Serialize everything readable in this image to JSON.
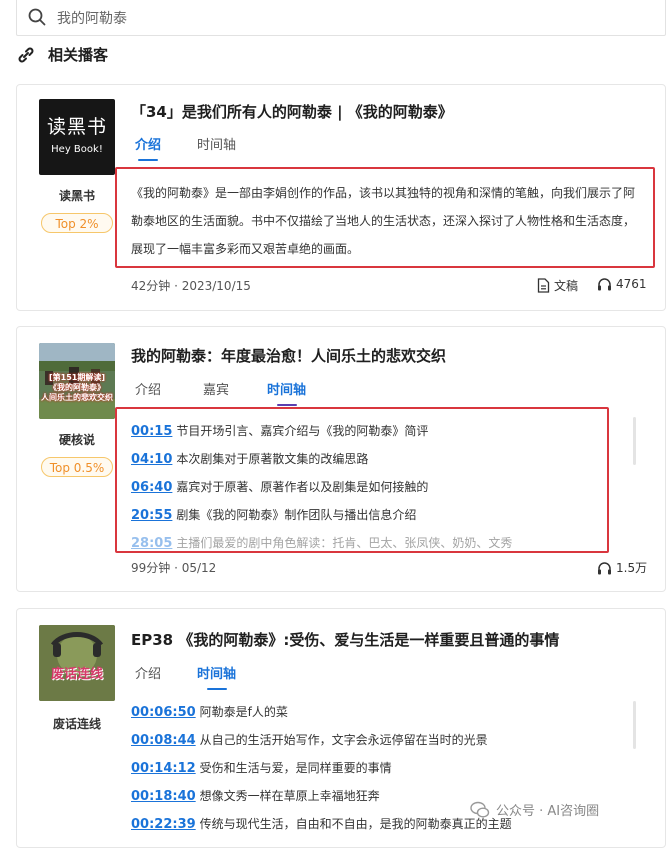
{
  "search": {
    "value": "我的阿勒泰"
  },
  "section": {
    "title": "相关播客"
  },
  "cards": [
    {
      "cover": {
        "line1": "读黑书",
        "line2": "Hey Book!"
      },
      "podcast": "读黑书",
      "badge": "Top 2%",
      "title": "「34」是我们所有人的阿勒泰 | 《我的阿勒泰》",
      "tabs": [
        "介绍",
        "时间轴"
      ],
      "active_tab": "介绍",
      "description": "《我的阿勒泰》是一部由李娟创作的作品，该书以其独特的视角和深情的笔触，向我们展示了阿勒泰地区的生活面貌。书中不仅描绘了当地人的生活状态，还深入探讨了人物性格和生活态度，展现了一幅丰富多彩而又艰苦卓绝的画面。",
      "meta": "42分钟 · 2023/10/15",
      "doc_label": "文稿",
      "plays": "4761"
    },
    {
      "cover": {
        "caption": "[第151期解读]\n《我的阿勒泰》\n人间乐土的悲欢交织"
      },
      "podcast": "硬核说",
      "badge": "Top 0.5%",
      "title": "我的阿勒泰：年度最治愈！人间乐土的悲欢交织",
      "tabs": [
        "介绍",
        "嘉宾",
        "时间轴"
      ],
      "active_tab": "时间轴",
      "timeline": [
        {
          "time": "00:15",
          "text": "节目开场引言、嘉宾介绍与《我的阿勒泰》简评"
        },
        {
          "time": "04:10",
          "text": "本次剧集对于原著散文集的改编思路"
        },
        {
          "time": "06:40",
          "text": "嘉宾对于原著、原著作者以及剧集是如何接触的"
        },
        {
          "time": "20:55",
          "text": "剧集《我的阿勒泰》制作团队与播出信息介绍"
        },
        {
          "time": "28:05",
          "text": "主播们最爱的剧中角色解读：托肯、巴太、张凤侠、奶奶、文秀"
        }
      ],
      "meta": "99分钟 · 05/12",
      "plays": "1.5万"
    },
    {
      "cover": {
        "caption": "废话连线"
      },
      "podcast": "废话连线",
      "title": "EP38 《我的阿勒泰》:受伤、爱与生活是一样重要且普通的事情",
      "tabs": [
        "介绍",
        "时间轴"
      ],
      "active_tab": "时间轴",
      "timeline": [
        {
          "time": "00:06:50",
          "text": "阿勒泰是f人的菜"
        },
        {
          "time": "00:08:44",
          "text": "从自己的生活开始写作，文字会永远停留在当时的光景"
        },
        {
          "time": "00:14:12",
          "text": "受伤和生活与爱，是同样重要的事情"
        },
        {
          "time": "00:18:40",
          "text": "想像文秀一样在草原上幸福地狂奔"
        },
        {
          "time": "00:22:39",
          "text": "传统与现代生活，自由和不自由，是我的阿勒泰真正的主题"
        }
      ]
    }
  ],
  "watermark": "公众号 · AI咨询圈",
  "colors": {
    "accent": "#1a73d9",
    "highlight_border": "#d9363e",
    "badge": "#f0902a"
  }
}
